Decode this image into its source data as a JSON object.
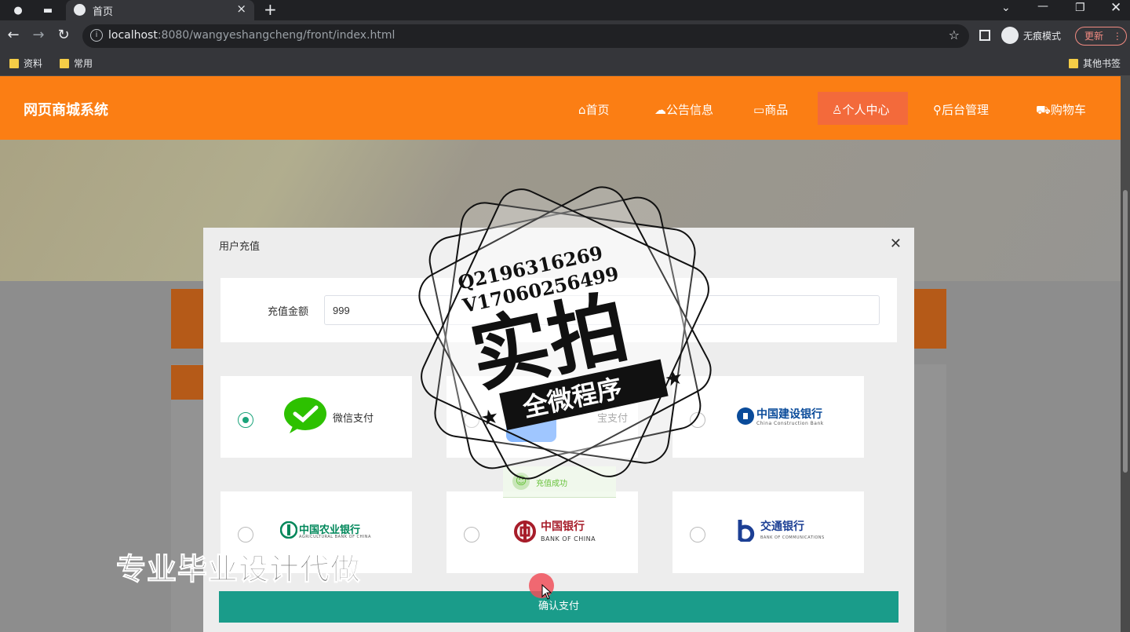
{
  "browser": {
    "tab_title": "首页",
    "url_host": "localhost",
    "url_path": ":8080/wangyeshangcheng/front/index.html",
    "incognito_label": "无痕模式",
    "update_label": "更新",
    "bookmarks": [
      "资料",
      "常用"
    ],
    "other_bookmarks": "其他书签"
  },
  "site": {
    "title": "网页商城系统",
    "nav": [
      {
        "icon": "home-icon",
        "label": "首页"
      },
      {
        "icon": "cloud-icon",
        "label": "公告信息"
      },
      {
        "icon": "book-icon",
        "label": "商品"
      },
      {
        "icon": "user-icon",
        "label": "个人中心"
      },
      {
        "icon": "link-icon",
        "label": "后台管理"
      },
      {
        "icon": "cart-icon",
        "label": "购物车"
      }
    ],
    "active_nav": "个人中心"
  },
  "modal": {
    "title": "用户充值",
    "amount_label": "充值金额",
    "amount_value": "999",
    "payment_methods": [
      {
        "label": "微信支付",
        "selected": true
      },
      {
        "label": "支付宝支付",
        "visible_label": "宝支付",
        "selected": false
      },
      {
        "label": "中国建设银行",
        "sub": "China Construction Bank",
        "selected": false
      },
      {
        "label": "中国农业银行",
        "sub": "AGRICULTURAL BANK OF CHINA",
        "selected": false
      },
      {
        "label": "中国银行",
        "sub": "BANK OF CHINA",
        "selected": false
      },
      {
        "label": "交通银行",
        "sub": "BANK OF COMMUNICATIONS",
        "selected": false
      }
    ],
    "confirm_label": "确认支付",
    "toast": "充值成功"
  },
  "overlays": {
    "stamp_line1": "Q2196316269",
    "stamp_line2": "V17060256499",
    "stamp_big": "实拍",
    "stamp_ribbon": "全微程序",
    "bottom_text": "专业毕业设计代做"
  },
  "colors": {
    "header": "#fb7e14",
    "nav_active": "#f36a3b",
    "confirm": "#1a9c8a",
    "wechat": "#2dc100",
    "ccb": "#0a4b9a",
    "abc": "#00875a",
    "boc": "#a71d2a",
    "bocom": "#1c3f94"
  }
}
